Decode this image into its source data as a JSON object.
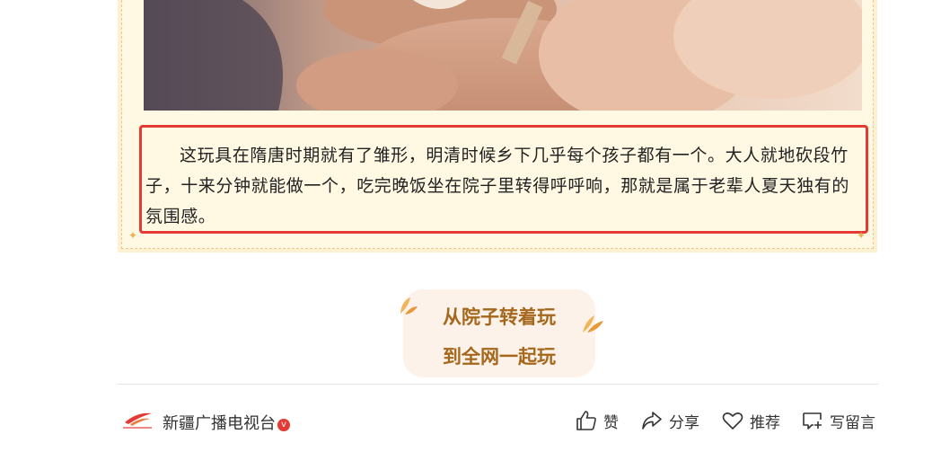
{
  "article": {
    "paragraph": "这玩具在隋唐时期就有了雏形，明清时候乡下几乎每个孩子都有一个。大人就地砍段竹子，十来分钟就能做一个，吃完晚饭坐在院子里转得呼呼响，那就是属于老辈人夏天独有的氛围感。"
  },
  "banner": {
    "line1": "从院子转着玩",
    "line2": "到全网一起玩"
  },
  "footer": {
    "account_name": "新疆广播电视台",
    "verified_mark": "v",
    "actions": {
      "like": "赞",
      "share": "分享",
      "recommend": "推荐",
      "comment": "写留言"
    }
  },
  "colors": {
    "highlight_border": "#e53935",
    "banner_text": "#a5671b",
    "frame_bg": "#fdf1d2"
  }
}
